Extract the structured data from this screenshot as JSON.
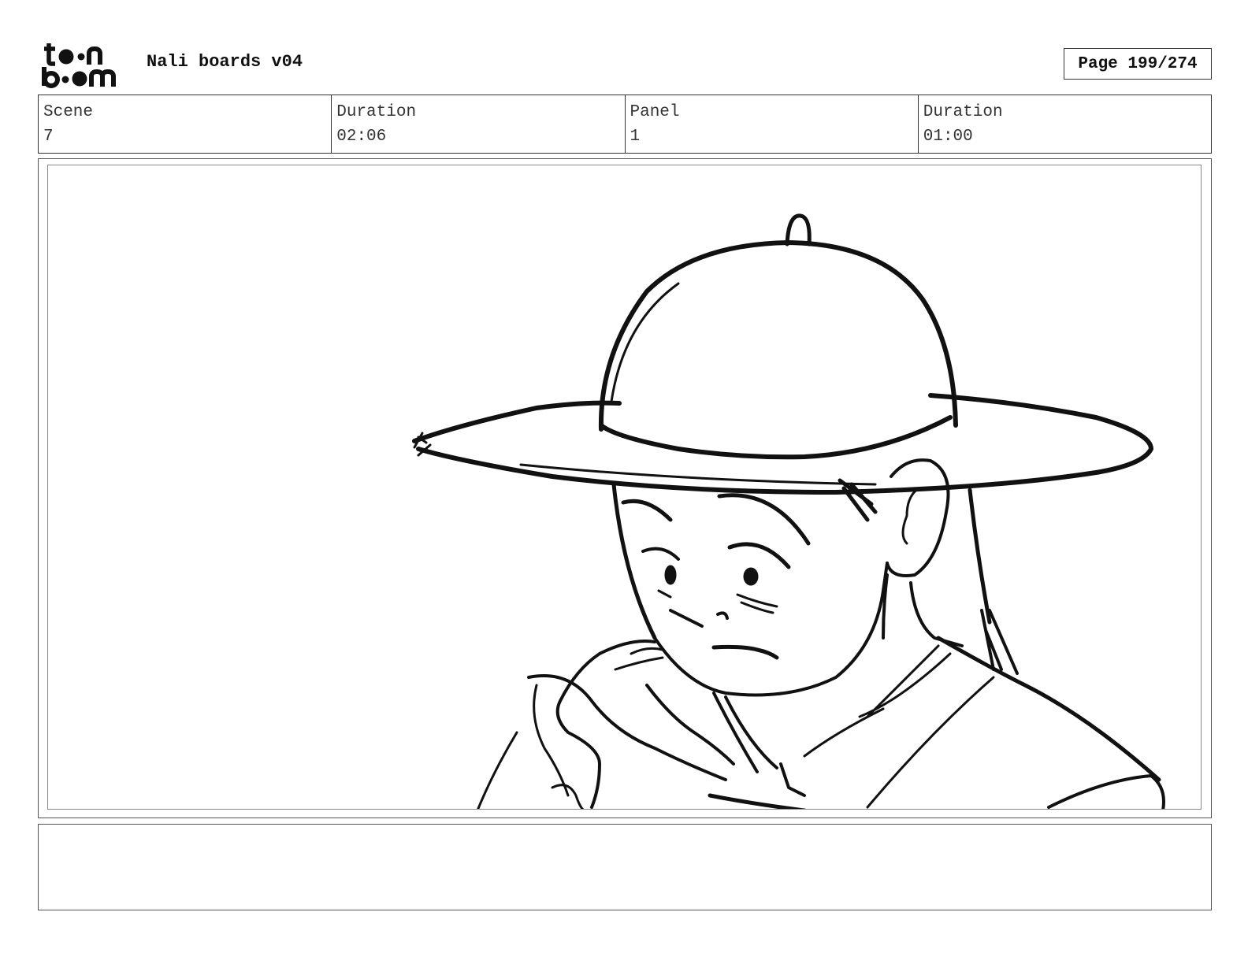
{
  "header": {
    "logo": {
      "line1": "toon",
      "line2": "boom",
      "icon": "toon-boom-logo"
    },
    "project_title": "Nali boards v04",
    "page_indicator": "Page 199/274"
  },
  "info_table": [
    {
      "label": "Scene",
      "value": "7"
    },
    {
      "label": "Duration",
      "value": "02:06"
    },
    {
      "label": "Panel",
      "value": "1"
    },
    {
      "label": "Duration",
      "value": "01:00"
    }
  ],
  "panel": {
    "image": "sketch-girl-in-wide-brim-hat"
  },
  "notes": {
    "text": ""
  }
}
